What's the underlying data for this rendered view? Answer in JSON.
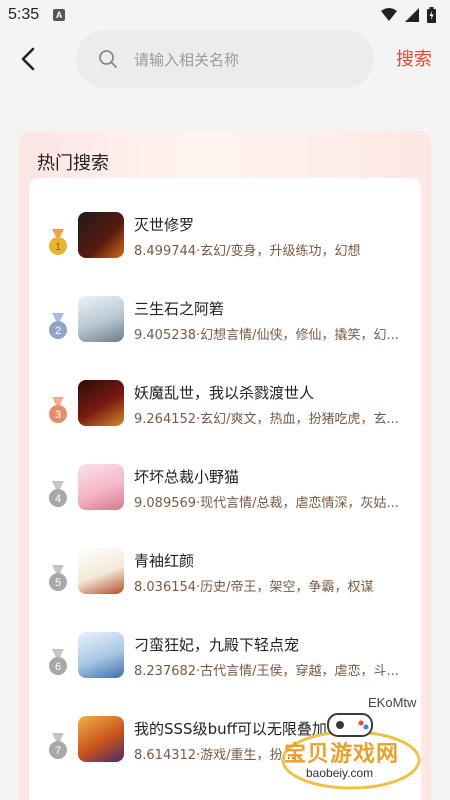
{
  "status_bar": {
    "time": "5:35",
    "notification_icon": "A"
  },
  "header": {
    "search_placeholder": "请输入相关名称",
    "search_button": "搜索"
  },
  "section": {
    "title": "热门搜索"
  },
  "books": [
    {
      "rank": 1,
      "title": "灭世修罗",
      "desc": "8.499744·玄幻/变身，升级练功，幻想",
      "medal": "gold"
    },
    {
      "rank": 2,
      "title": "三生石之阿箬",
      "desc": "9.405238·幻想言情/仙侠，修仙，撬笑，幻...",
      "medal": "silver"
    },
    {
      "rank": 3,
      "title": "妖魔乱世，我以杀戮渡世人",
      "desc": "9.264152·玄幻/爽文，热血，扮猪吃虎，玄...",
      "medal": "bronze"
    },
    {
      "rank": 4,
      "title": "坏坏总裁小野猫",
      "desc": "9.089569·现代言情/总裁，虐恋情深，灰姑...",
      "medal": "gray"
    },
    {
      "rank": 5,
      "title": "青袖红颜",
      "desc": "8.036154·历史/帝王，架空，争霸，权谋",
      "medal": "gray"
    },
    {
      "rank": 6,
      "title": "刁蛮狂妃，九殿下轻点宠",
      "desc": "8.237682·古代言情/王侯，穿越，虐恋，斗...",
      "medal": "gray"
    },
    {
      "rank": 7,
      "title": "我的SSS级buff可以无限叠加",
      "desc": "8.614312·游戏/重生，扮...",
      "medal": "gray"
    }
  ],
  "watermark": {
    "tag": "EKoMtw",
    "name": "宝贝游戏网",
    "url": "baobeiy.com"
  },
  "colors": {
    "accent": "#e24a3b",
    "gold": "#e6b432",
    "silver": "#8fa4c6",
    "bronze": "#e28f68",
    "gray": "#a8a8a8"
  }
}
